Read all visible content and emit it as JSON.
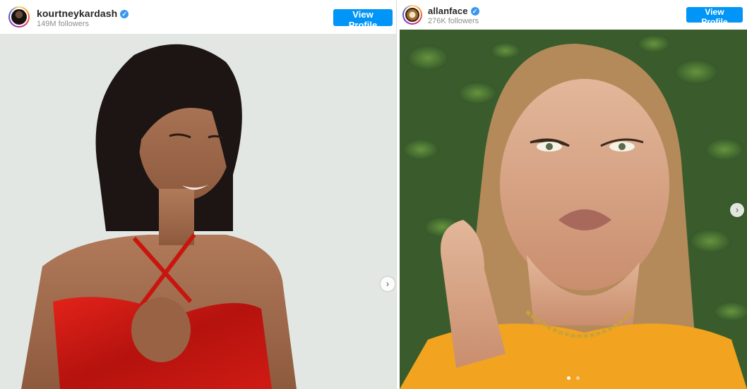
{
  "left_post": {
    "username": "kourtneykardash",
    "verified_mark": "✓",
    "followers": "149M followers",
    "view_profile_label": "View Profile",
    "next_arrow": "›",
    "icons": {
      "avatar": "profile-avatar",
      "verified": "verified-badge-icon",
      "next": "chevron-right-icon"
    }
  },
  "right_post": {
    "username": "allanface",
    "verified_mark": "✓",
    "followers": "276K followers",
    "view_profile_label": "View Profile",
    "next_arrow": "›",
    "icons": {
      "avatar": "profile-avatar",
      "verified": "verified-badge-icon",
      "next": "chevron-right-icon"
    }
  },
  "colors": {
    "button": "#0095f6",
    "verified": "#3897f0",
    "username": "#262626",
    "followers": "#8e8e8e"
  }
}
